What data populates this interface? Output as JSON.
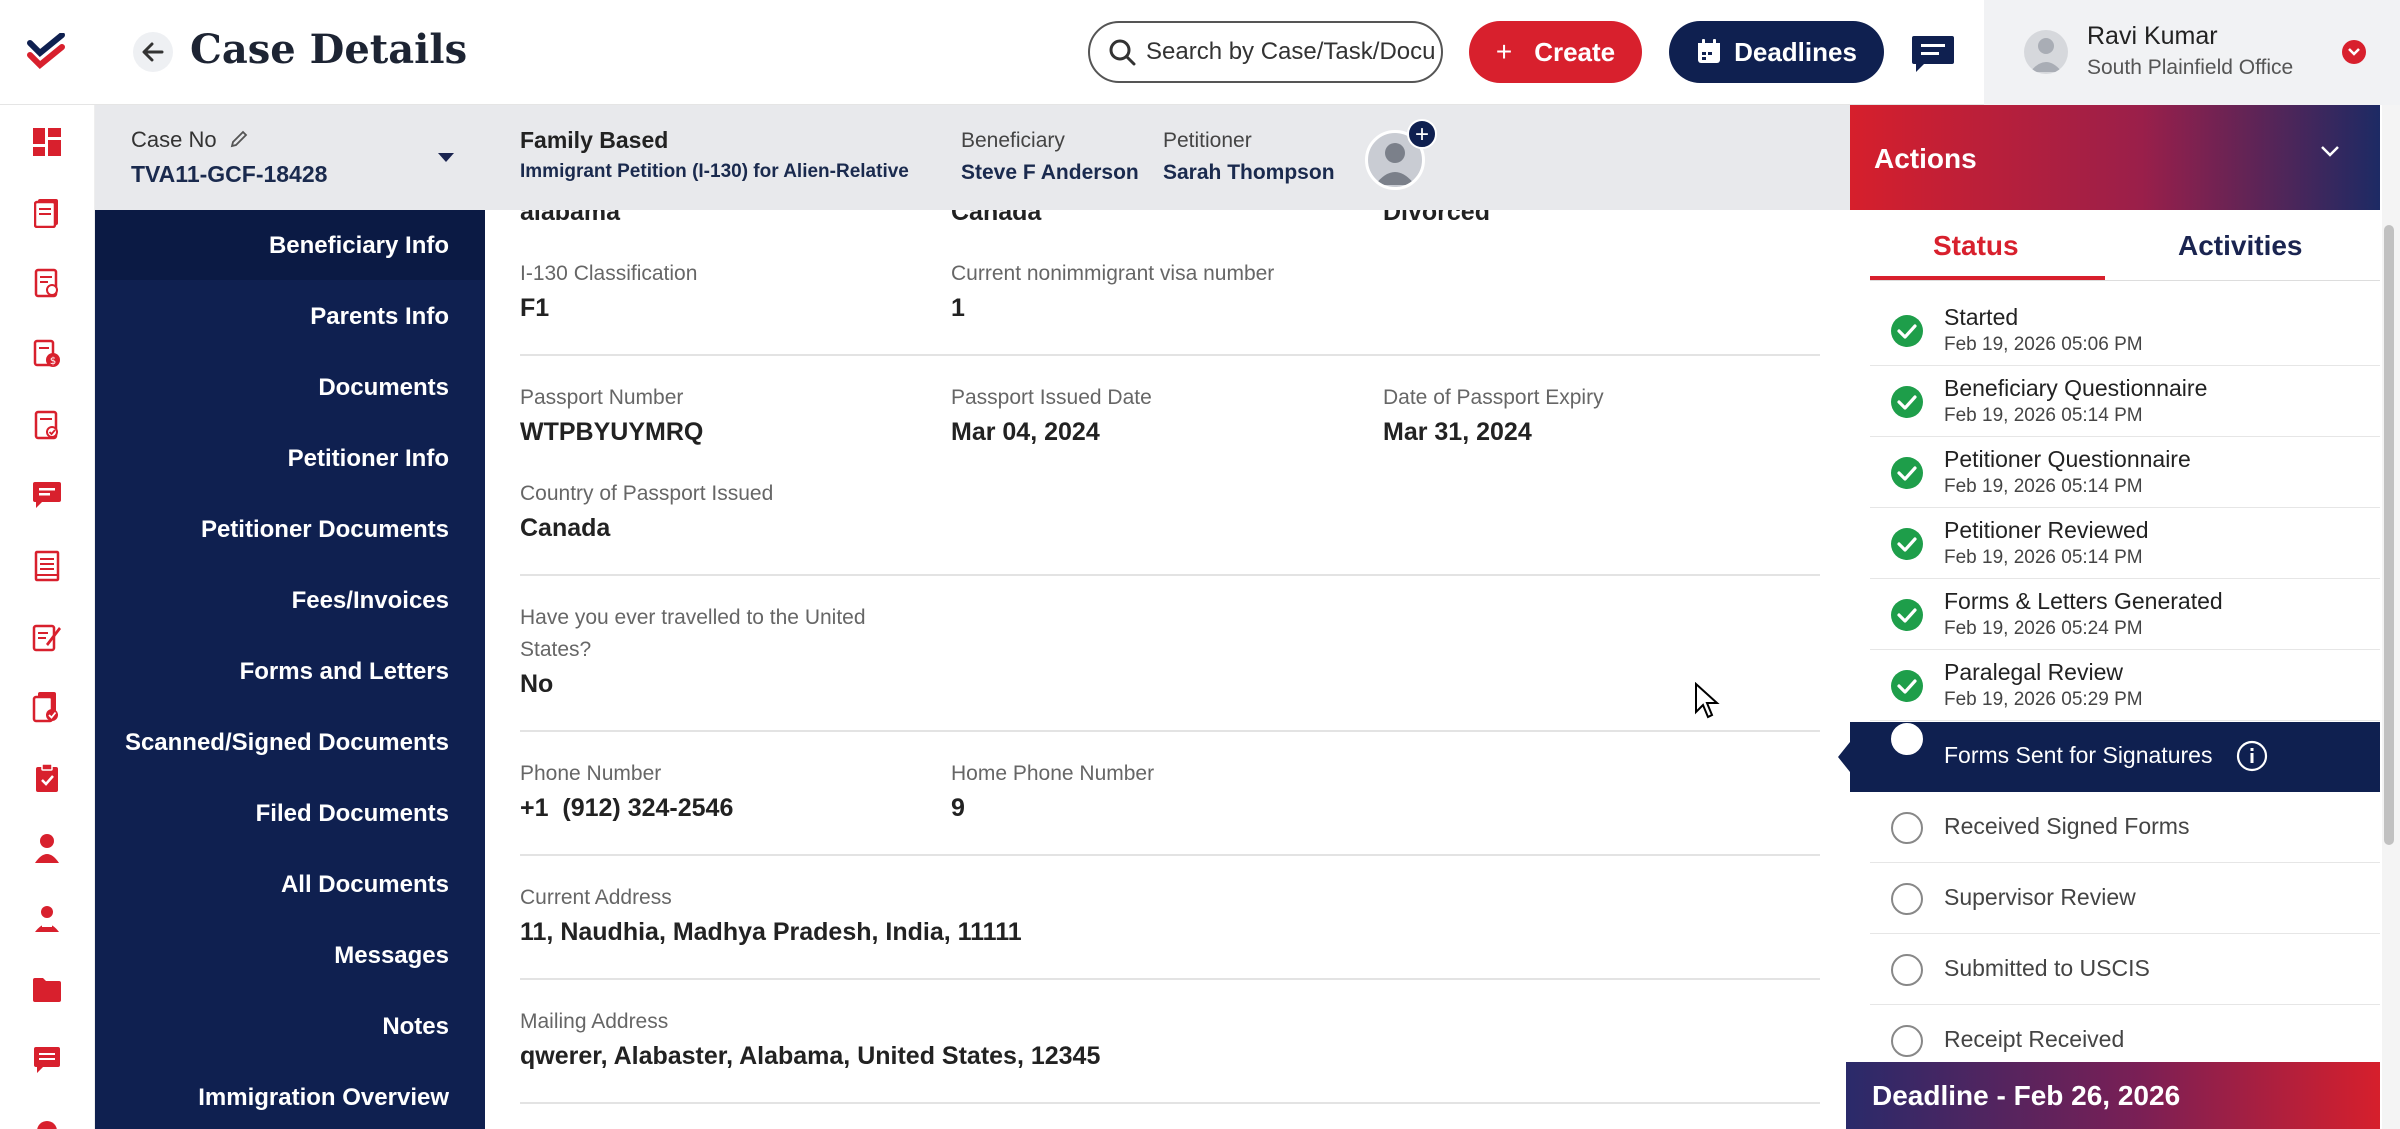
{
  "header": {
    "title": "Case Details",
    "search_placeholder": "Search by Case/Task/Docu",
    "create_label": "Create",
    "deadlines_label": "Deadlines",
    "user_name": "Ravi Kumar",
    "user_office": "South Plainfield Office"
  },
  "rail": {
    "icons": [
      "dashboard-icon",
      "cases-icon",
      "tasks-icon",
      "invoices-icon",
      "checklist-icon",
      "messages-icon",
      "documents-icon",
      "forms-icon",
      "templates-icon",
      "clipboard-icon",
      "clients-icon",
      "users-icon",
      "folder-icon",
      "reports-icon"
    ]
  },
  "casebar": {
    "case_no_label": "Case No",
    "case_no": "TVA11-GCF-18428",
    "case_type": "Family Based",
    "case_subtype": "Immigrant Petition (I-130) for Alien-Relative",
    "beneficiary_label": "Beneficiary",
    "beneficiary": "Steve F Anderson",
    "petitioner_label": "Petitioner",
    "petitioner": "Sarah Thompson"
  },
  "sections": [
    "Beneficiary Info",
    "Parents Info",
    "Documents",
    "Petitioner Info",
    "Petitioner Documents",
    "Fees/Invoices",
    "Forms and Letters",
    "Scanned/Signed Documents",
    "Filed Documents",
    "All Documents",
    "Messages",
    "Notes",
    "Immigration Overview"
  ],
  "details": {
    "partial_row": [
      "alabama",
      "Canada",
      "Divorced"
    ],
    "i130_label": "I-130 Classification",
    "i130": "F1",
    "visa_label": "Current nonimmigrant visa number",
    "visa": "1",
    "passport_no_label": "Passport Number",
    "passport_no": "WTPBYUYMRQ",
    "passport_issued_label": "Passport Issued Date",
    "passport_issued": "Mar 04, 2024",
    "passport_expiry_label": "Date of Passport Expiry",
    "passport_expiry": "Mar 31, 2024",
    "passport_country_label": "Country of Passport Issued",
    "passport_country": "Canada",
    "travelled_label_1": "Have you ever travelled to the United",
    "travelled_label_2": "States?",
    "travelled": "No",
    "phone_label": "Phone Number",
    "phone": "+1  (912) 324-2546",
    "home_phone_label": "Home Phone Number",
    "home_phone": "9",
    "current_address_label": "Current Address",
    "current_address": "11, Naudhia, Madhya Pradesh, India, 11111",
    "mailing_address_label": "Mailing Address",
    "mailing_address": "qwerer, Alabaster, Alabama, United States, 12345"
  },
  "actions": {
    "title": "Actions",
    "tab_status": "Status",
    "tab_activities": "Activities",
    "steps": [
      {
        "name": "Started",
        "date": "Feb 19, 2026 05:06 PM",
        "state": "done"
      },
      {
        "name": "Beneficiary Questionnaire",
        "date": "Feb 19, 2026 05:14 PM",
        "state": "done"
      },
      {
        "name": "Petitioner Questionnaire",
        "date": "Feb 19, 2026 05:14 PM",
        "state": "done"
      },
      {
        "name": "Petitioner Reviewed",
        "date": "Feb 19, 2026 05:14 PM",
        "state": "done"
      },
      {
        "name": "Forms & Letters Generated",
        "date": "Feb 19, 2026 05:24 PM",
        "state": "done"
      },
      {
        "name": "Paralegal Review",
        "date": "Feb 19, 2026 05:29 PM",
        "state": "done"
      },
      {
        "name": "Forms Sent for Signatures",
        "date": "",
        "state": "current"
      },
      {
        "name": "Received Signed Forms",
        "date": "",
        "state": "pending"
      },
      {
        "name": "Supervisor Review",
        "date": "",
        "state": "pending"
      },
      {
        "name": "Submitted to USCIS",
        "date": "",
        "state": "pending"
      },
      {
        "name": "Receipt Received",
        "date": "",
        "state": "pending"
      }
    ],
    "deadline": "Deadline - Feb 26, 2026"
  },
  "colors": {
    "brand_red": "#d8202d",
    "brand_navy": "#0f2050",
    "done_green": "#1e9e4a"
  }
}
